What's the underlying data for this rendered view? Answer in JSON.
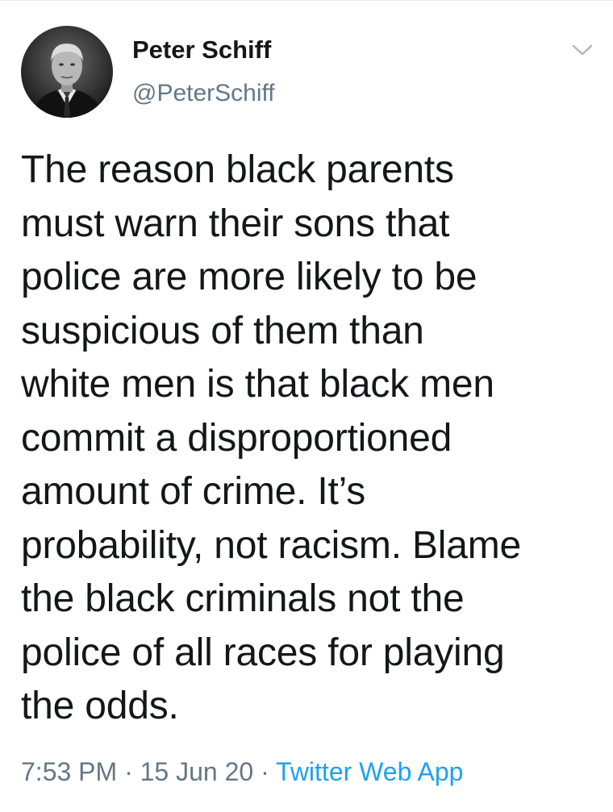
{
  "author": {
    "display_name": "Peter Schiff",
    "handle": "@PeterSchiff",
    "avatar_icon": "profile-photo"
  },
  "menu": {
    "icon": "chevron-down-icon"
  },
  "tweet": {
    "lines": [
      "The reason black parents",
      "must warn their sons that",
      "police are more likely to be",
      "suspicious of them than",
      "white men is that black men",
      "commit a disproportioned",
      "amount of crime. It’s",
      "probability, not racism. Blame",
      "the black criminals not the",
      "police of all races for playing",
      "the odds."
    ]
  },
  "meta": {
    "time": "7:53 PM",
    "separator": "·",
    "date": "15 Jun 20",
    "source": "Twitter Web App"
  },
  "colors": {
    "text": "#14171a",
    "secondary": "#657786",
    "link": "#1da1f2"
  }
}
